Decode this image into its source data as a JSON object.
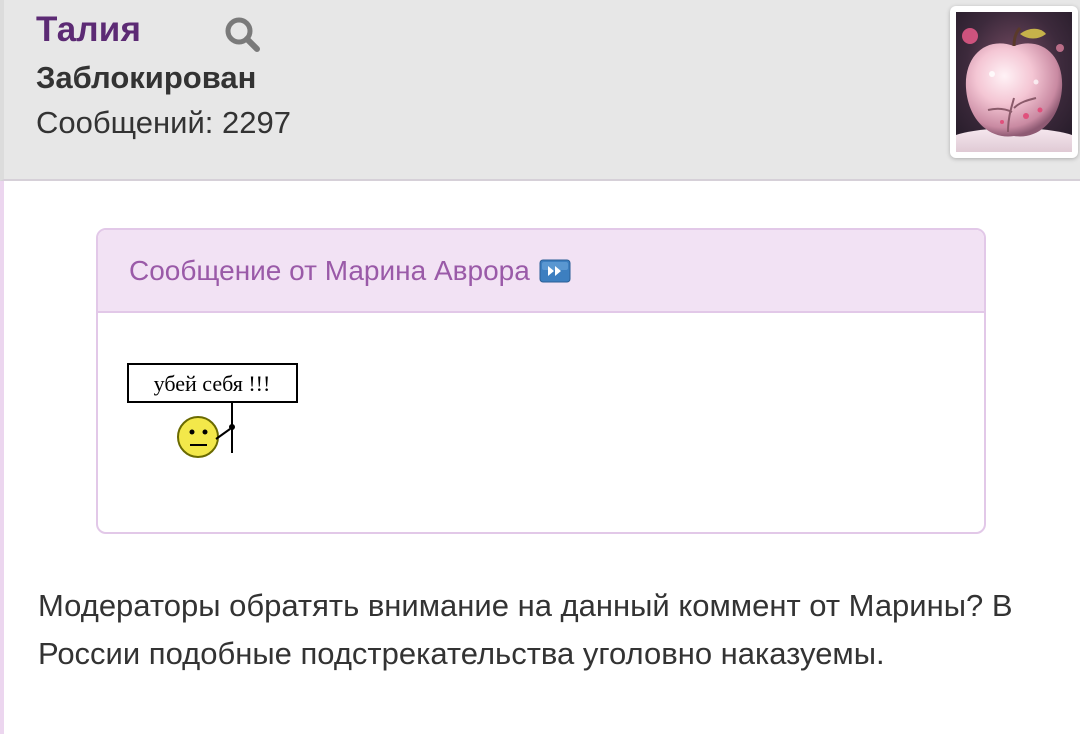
{
  "post": {
    "username": "Талия",
    "status": "Заблокирован",
    "posts_label": "Сообщений:",
    "posts_count": "2297",
    "avatar_icon": "pink-apple-avatar",
    "search_icon": "search-icon"
  },
  "quote": {
    "title": "Сообщение от Марина Аврора",
    "jump_icon": "jump-to-post-icon",
    "smiley_sign_text": "убей себя !!!",
    "smiley_icon": "smiley-with-sign"
  },
  "body": {
    "text": "Модераторы обратять внимание на данный коммент от Марины? В России подобные подстрекательства уголовно наказуемы."
  },
  "colors": {
    "username": "#5c2a74",
    "quote_title": "#9a5aa8",
    "quote_header_bg": "#f2e2f4",
    "quote_border": "#e2c8e8",
    "header_bg": "#e7e7e7"
  }
}
